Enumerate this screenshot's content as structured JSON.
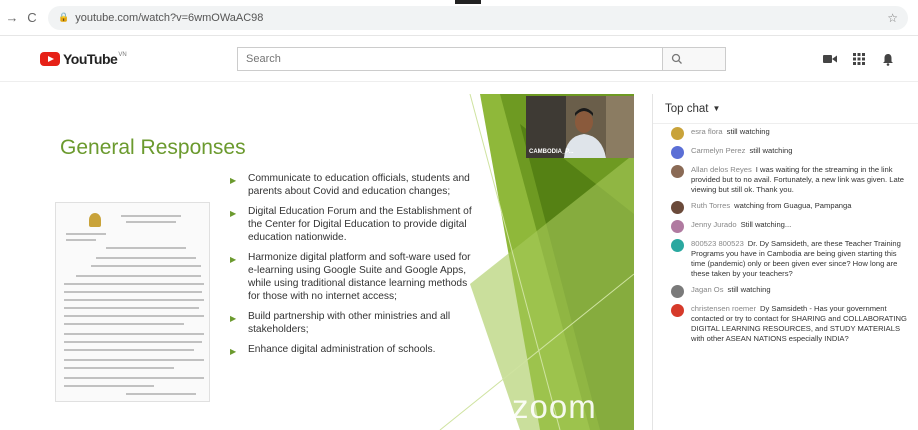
{
  "browser": {
    "url": "youtube.com/watch?v=6wmOWaAC98"
  },
  "youtube": {
    "logo_text": "YouTube",
    "logo_region": "VN",
    "search_placeholder": "Search"
  },
  "slide": {
    "title": "General Responses",
    "bullets": [
      "Communicate to education officials, students and parents about Covid and education changes;",
      "Digital Education Forum and the Establishment of the Center for Digital Education to provide digital education nationwide.",
      "Harmonize digital platform and soft-ware used for e-learning using Google Suite and Google Apps, while using traditional distance learning methods for those with no internet access;",
      "Build partnership with other ministries and all stakeholders;",
      "Enhance digital administration of schools."
    ],
    "webcam_label": "CAMBODIA_P...",
    "watermark": "zoom"
  },
  "chat": {
    "header": "Top chat",
    "messages": [
      {
        "author": "esra flora",
        "text": "still watching",
        "color": "#c9a33a"
      },
      {
        "author": "Carmelyn Perez",
        "text": "still watching",
        "color": "#5b6fd6"
      },
      {
        "author": "Allan delos Reyes",
        "text": "I was waiting for the streaming in the link provided but to no avail. Fortunately, a new link was given. Late viewing but still ok. Thank you.",
        "color": "#8a6a55"
      },
      {
        "author": "Ruth Torres",
        "text": "watching from Guagua, Pampanga",
        "color": "#6b4a3a"
      },
      {
        "author": "Jenny Jurado",
        "text": "Still watching...",
        "color": "#b07aa0"
      },
      {
        "author": "800523 800523",
        "text": "Dr. Dy Samsideth, are these Teacher Training Programs you have in Cambodia are being given starting this time (pandemic) only or been given ever since? How long are these taken by your teachers?",
        "color": "#2aa8a0"
      },
      {
        "author": "Jagan Os",
        "text": "still watching",
        "color": "#7a7a7a"
      },
      {
        "author": "christensen roemer",
        "text": "Dy Samsideth - Has your government contacted or try to contact for SHARING and COLLABORATING DIGITAL LEARNING RESOURCES, and STUDY MATERIALS with other ASEAN NATIONS especially INDIA?",
        "color": "#d63a2a"
      }
    ]
  }
}
